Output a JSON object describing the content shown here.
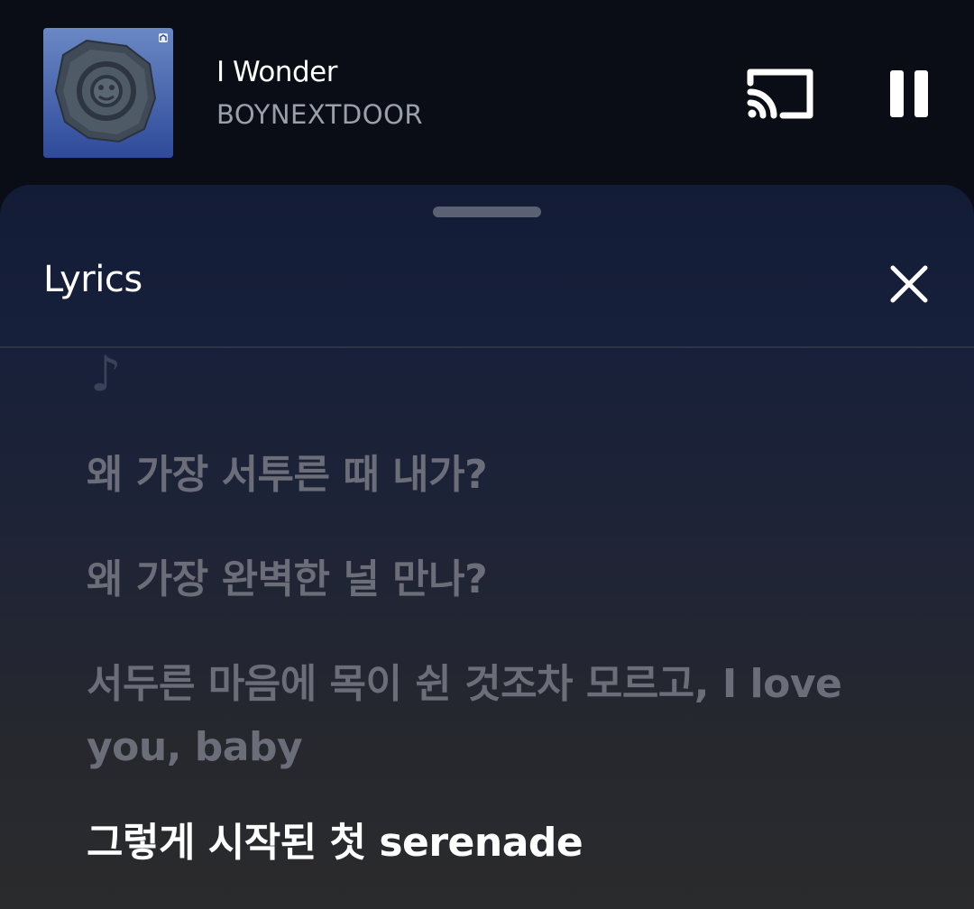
{
  "now_playing": {
    "title": "I Wonder",
    "artist": "BOYNEXTDOOR",
    "cast_icon": "cast-icon",
    "pause_icon": "pause-icon"
  },
  "lyrics_panel": {
    "title": "Lyrics",
    "close_icon": "close-icon",
    "note_symbol": "♪",
    "lines": [
      "왜 가장 서투른 때 내가?",
      "왜 가장 완벽한 널 만나?",
      "서두른 마음에 목이 쉰 것조차 모르고, I love you, baby",
      "그렇게 시작된 첫 serenade"
    ],
    "active_line": 3
  },
  "colors": {
    "background": "#0a0d16",
    "sheet_top": "#131c36",
    "sheet_bottom": "#2b2b2d",
    "active_lyric": "#ffffff",
    "inactive_lyric": "#6b6e78",
    "artist_text": "#9aa0ab"
  }
}
